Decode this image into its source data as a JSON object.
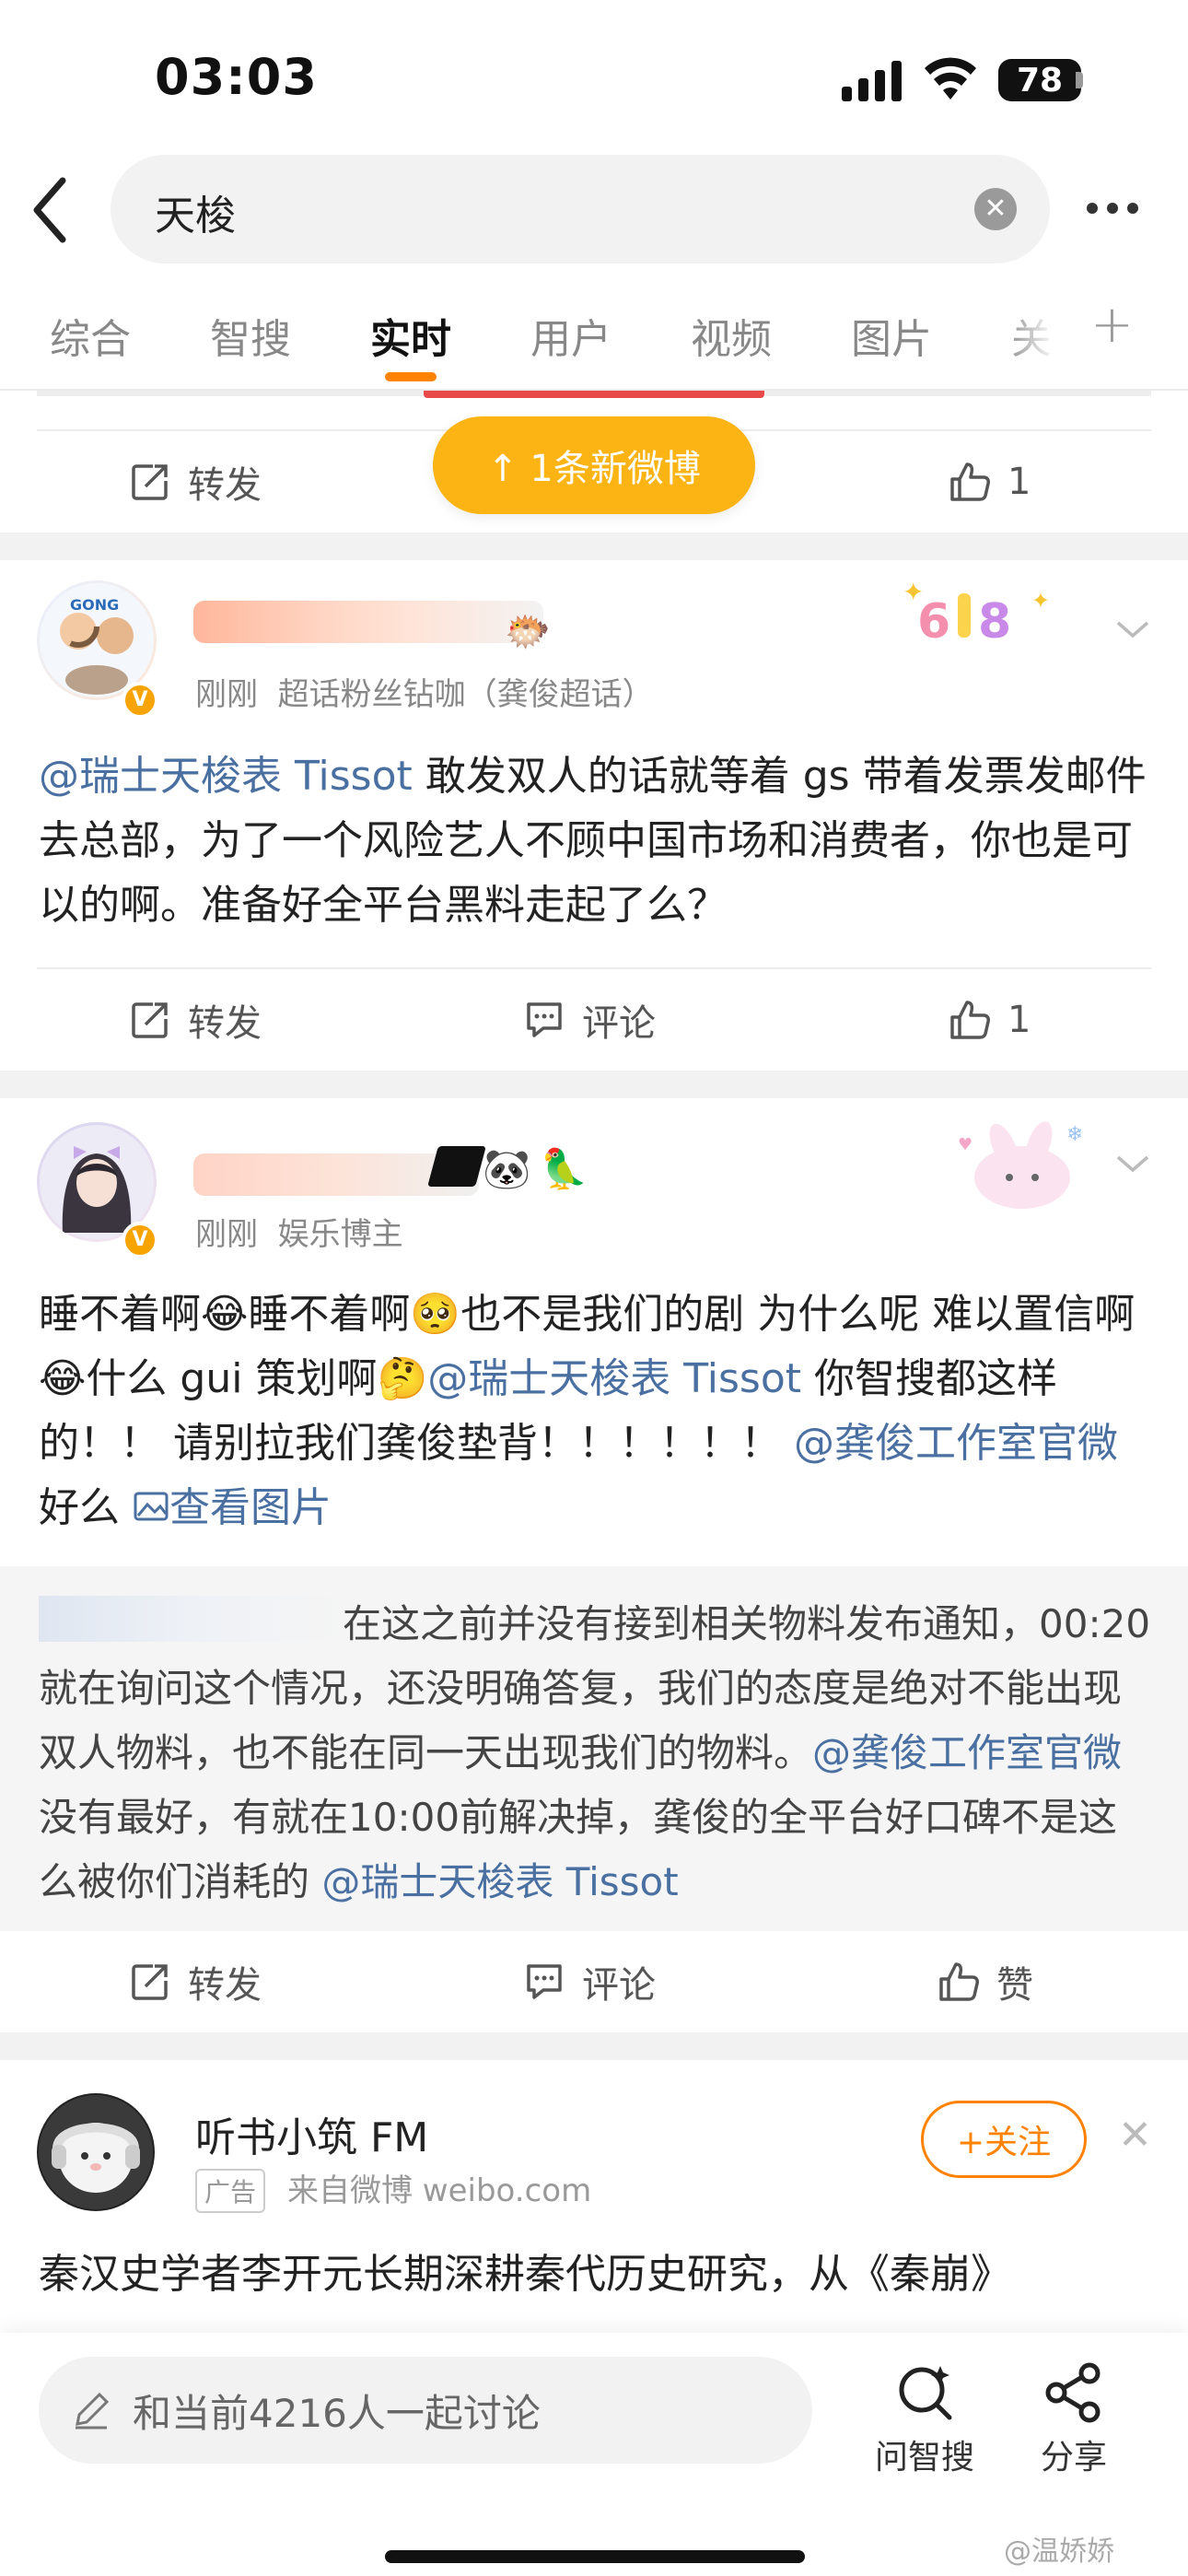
{
  "status_bar": {
    "time": "03:03",
    "battery": "78"
  },
  "search": {
    "query": "天梭"
  },
  "tabs": [
    "综合",
    "智搜",
    "实时",
    "用户",
    "视频",
    "图片",
    "关"
  ],
  "new_post_label": "↑ 1条新微博",
  "top_actions": {
    "repost": "转发",
    "like_count": "1"
  },
  "post1": {
    "time": "刚刚",
    "source": "超话粉丝钻咖（龚俊超话）",
    "mention": "@瑞士天梭表 Tissot",
    "text": " 敢发双人的话就等着 gs 带着发票发邮件去总部，为了一个风险艺人不顾中国市场和消费者，你也是可以的啊。准备好全平台黑料走起了么？",
    "repost": "转发",
    "comment": "评论",
    "likes": "1"
  },
  "post2": {
    "time": "刚刚",
    "source": "娱乐博主",
    "text_part1": "睡不着啊",
    "text_part2": "睡不着啊",
    "text_part3": "也不是我们的剧 为什么呢 难以置信啊",
    "text_part4": "什么 gui 策划啊",
    "mention1": "@瑞士天梭表 Tissot",
    "text_part5": " 你智搜都这样的！！ 请别拉我们龚俊垫背！！！！！！ ",
    "mention2": "@龚俊工作室官微",
    "text_part6": " 好么 ",
    "view_image": "查看图片",
    "repost_line1": "在这之前并没有接到相关物料发布通知，00:20就在询问这个情况，还没明确答复，我们的态度是绝对不能出现双人物料，也不能在同一天出现我们的物料。",
    "repost_mention1": "@龚俊工作室官微",
    "repost_line2": " 没有最好，有就在10:00前解决掉，龚俊的全平台好口碑不是这么被你们消耗的 ",
    "repost_mention2": "@瑞士天梭表 Tissot",
    "repost": "转发",
    "comment": "评论",
    "like": "赞"
  },
  "ad": {
    "name": "听书小筑 FM",
    "tag": "广告",
    "source": "来自微博 weibo.com",
    "follow": "+关注",
    "text": "秦汉史学者李开元长期深耕秦代历史研究，从《秦崩》"
  },
  "bottom": {
    "compose_placeholder": "和当前4216人一起讨论",
    "smart_search": "问智搜",
    "share": "分享",
    "watermark": "@温娇娇"
  }
}
